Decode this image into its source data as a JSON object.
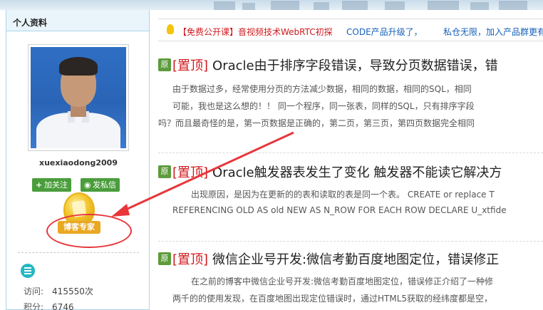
{
  "sidebar": {
    "title": "个人资料",
    "username": "xuexiaodong2009",
    "follow_label": "加关注",
    "message_label": "发私信",
    "badge_text": "博客专家",
    "stats": [
      {
        "label": "访问:",
        "value": "415550次"
      },
      {
        "label": "积分:",
        "value": "6746"
      }
    ]
  },
  "notice": {
    "part1": "【免费公开课】音视频技术WebRTC初探",
    "part2": "CODE产品升级了，",
    "part3": "私仓无限，加入产品群更有福利"
  },
  "articles": [
    {
      "badge": "原",
      "tag": "[置顶]",
      "title": "Oracle由于排序字段错误，导致分页数据错误，错",
      "lines": [
        "由于数据过多，经常使用分页的方法减少数据，相同的数据，相同的SQL，相同",
        "可能，我也是这么想的！！    同一个程序，同一张表，同样的SQL，只有排序字段",
        "吗？而且最奇怪的是，第一页数据是正确的，第二页，第三页，第四页数据完全相同"
      ]
    },
    {
      "badge": "原",
      "tag": "[置顶]",
      "title": "Oracle触发器表发生了变化 触发器不能读它解决方",
      "lines": [
        "出现原因，是因为在更新的的表和读取的表是同一个表。 CREATE or replace T",
        "REFERENCING OLD AS old NEW AS N_ROW FOR EACH ROW DECLARE U_xtfide"
      ]
    },
    {
      "badge": "原",
      "tag": "[置顶]",
      "title": "微信企业号开发:微信考勤百度地图定位，错误修正",
      "lines": [
        "在之前的博客中微信企业号开发:微信考勤百度地图定位，错误修正介绍了一种修",
        "两千的的使用发现，在百度地图出现定位错误时，通过HTML5获取的经纬度都是空，"
      ]
    }
  ],
  "colors": {
    "accent_red": "#d0191e",
    "link_blue": "#1560b8",
    "green_button": "#4a9d3b",
    "sidebar_border": "#a9d6ea"
  }
}
